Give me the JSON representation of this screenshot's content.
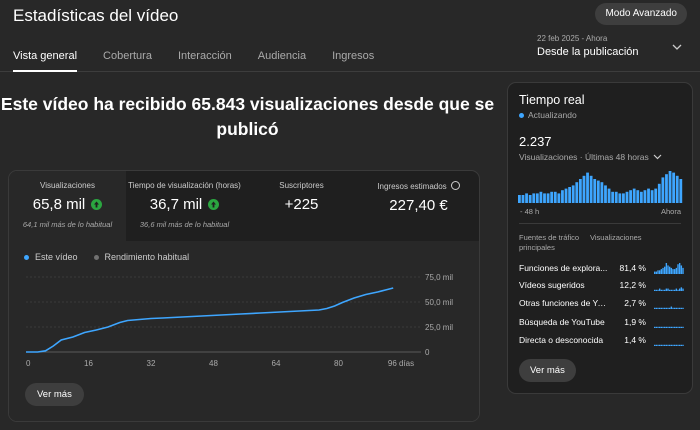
{
  "header": {
    "title": "Estadísticas del vídeo",
    "advanced_button": "Modo Avanzado",
    "tabs": [
      {
        "label": "Vista general",
        "active": true
      },
      {
        "label": "Cobertura",
        "active": false
      },
      {
        "label": "Interacción",
        "active": false
      },
      {
        "label": "Audiencia",
        "active": false
      },
      {
        "label": "Ingresos",
        "active": false
      }
    ],
    "date_range": "22 feb 2025 - Ahora",
    "date_label": "Desde la publicación"
  },
  "headline": "Este vídeo ha recibido 65.843 visualizaciones desde que se publicó",
  "metrics": [
    {
      "title": "Visualizaciones",
      "value": "65,8 mil",
      "note": "64,1 mil más de lo habitual",
      "trend_up": true
    },
    {
      "title": "Tiempo de visualización (horas)",
      "value": "36,7 mil",
      "note": "36,6 mil más de lo habitual",
      "trend_up": true
    },
    {
      "title": "Suscriptores",
      "value": "+225",
      "note": ""
    },
    {
      "title": "Ingresos estimados",
      "value": "227,40 €",
      "note": "",
      "info_icon": true
    }
  ],
  "legend": {
    "this_video": "Este vídeo",
    "typical": "Rendimiento habitual"
  },
  "see_more": "Ver más",
  "colors": {
    "accent": "#3ea6ff",
    "up": "#2ba640",
    "typical": "#717171"
  },
  "chart_data": {
    "type": "line",
    "x_ticks": [
      "0",
      "16",
      "32",
      "48",
      "64",
      "80",
      "96 días"
    ],
    "y_ticks": [
      "0",
      "25,0 mil",
      "50,0 mil",
      "75,0 mil"
    ],
    "ylim": [
      0,
      75000
    ],
    "xlim": [
      0,
      96
    ],
    "grid": true,
    "series": [
      {
        "name": "Este vídeo",
        "x": [
          0,
          3,
          5,
          7,
          9,
          12,
          15,
          18,
          21,
          24,
          26,
          29,
          32,
          35,
          40,
          45,
          50,
          55,
          60,
          65,
          70,
          75,
          77,
          79,
          81,
          84,
          87,
          90,
          92,
          94
        ],
        "y": [
          0,
          0,
          1200,
          6000,
          12000,
          15000,
          19500,
          22000,
          25000,
          29500,
          31500,
          32500,
          33500,
          34000,
          35000,
          36000,
          37000,
          38000,
          39000,
          40000,
          41000,
          42000,
          43500,
          46000,
          49500,
          54000,
          57500,
          60000,
          62000,
          64000
        ]
      }
    ]
  },
  "realtime": {
    "title": "Tiempo real",
    "status": "Actualizando",
    "count": "2.237",
    "subtitle": "Visualizaciones · Últimas 48 horas",
    "axis_left": "- 48 h",
    "axis_right": "Ahora",
    "col_source": "Fuentes de tráfico principales",
    "col_views": "Visualizaciones",
    "bars": [
      5,
      5,
      6,
      5,
      6,
      6,
      7,
      6,
      6,
      7,
      7,
      6,
      8,
      9,
      10,
      11,
      13,
      15,
      17,
      19,
      17,
      15,
      14,
      13,
      11,
      9,
      7,
      7,
      6,
      6,
      7,
      8,
      9,
      8,
      7,
      8,
      9,
      8,
      9,
      12,
      16,
      18,
      20,
      19,
      17,
      15
    ],
    "sources": [
      {
        "name": "Funciones de explora...",
        "pct": "81,4 %",
        "spark": [
          2,
          2,
          3,
          3,
          4,
          5,
          6,
          9,
          7,
          6,
          5,
          4,
          4,
          5,
          8,
          9,
          7,
          5
        ]
      },
      {
        "name": "Vídeos sugeridos",
        "pct": "12,2 %",
        "spark": [
          1,
          1,
          1,
          2,
          1,
          1,
          1,
          2,
          2,
          1,
          1,
          1,
          1,
          2,
          1,
          2,
          3,
          2
        ]
      },
      {
        "name": "Otras funciones de Yo...",
        "pct": "2,7 %",
        "spark": [
          1,
          1,
          1,
          1,
          1,
          1,
          1,
          1,
          1,
          1,
          2,
          1,
          1,
          1,
          1,
          1,
          1,
          1
        ]
      },
      {
        "name": "Búsqueda de YouTube",
        "pct": "1,9 %",
        "spark": [
          1,
          1,
          1,
          1,
          1,
          1,
          1,
          1,
          1,
          1,
          1,
          1,
          1,
          1,
          1,
          1,
          1,
          1
        ]
      },
      {
        "name": "Directa o desconocida",
        "pct": "1,4 %",
        "spark": [
          1,
          1,
          1,
          1,
          1,
          1,
          1,
          1,
          1,
          1,
          1,
          1,
          1,
          1,
          1,
          1,
          1,
          1
        ]
      }
    ],
    "see_more": "Ver más"
  }
}
